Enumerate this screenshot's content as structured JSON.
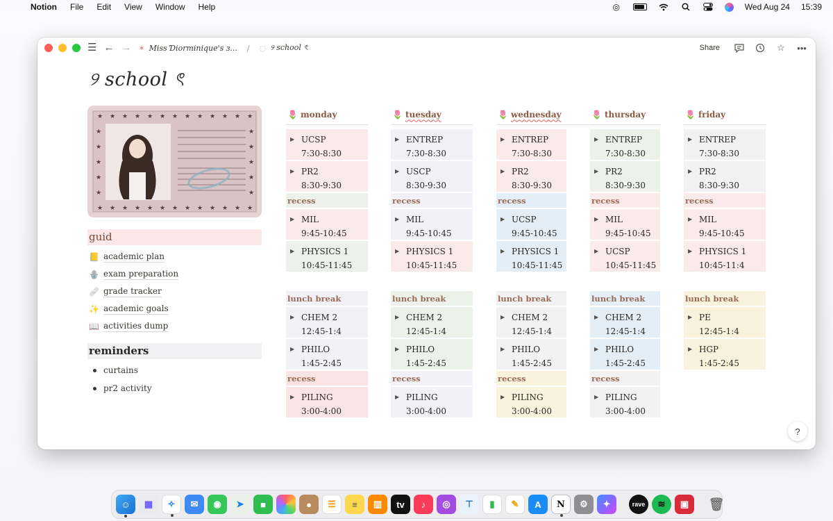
{
  "menubar": {
    "app_name": "Notion",
    "menus": [
      "File",
      "Edit",
      "View",
      "Window",
      "Help"
    ],
    "date": "Wed Aug 24",
    "time": "15:39"
  },
  "titlebar": {
    "breadcrumb_parent": "Miss Ɗiorminique's ɜ...",
    "breadcrumb_current": "୨ school ৎ",
    "share_label": "Share"
  },
  "page": {
    "title": "୨ school ৎ"
  },
  "guide": {
    "heading": "guid",
    "items": [
      {
        "emoji": "📒",
        "label": "academic plan"
      },
      {
        "emoji": "🪬",
        "label": "exam preparation"
      },
      {
        "emoji": "🩹",
        "label": "grade tracker"
      },
      {
        "emoji": "✨",
        "label": "academic goals"
      },
      {
        "emoji": "📖",
        "label": "activities dump"
      }
    ]
  },
  "reminders": {
    "heading": "reminders",
    "items": [
      "curtains",
      "pr2 activity"
    ]
  },
  "days": [
    {
      "name": "monday",
      "am": [
        {
          "subject": "UCSP",
          "time": "7:30-8:30"
        },
        {
          "subject": "PR2",
          "time": "8:30-9:30"
        }
      ],
      "recess1": "recess",
      "mid": [
        {
          "subject": "MIL",
          "time": "9:45-10:45"
        },
        {
          "subject": "PHYSICS 1",
          "time": "10:45-11:45"
        }
      ],
      "lunch": "lunch break",
      "pm": [
        {
          "subject": "CHEM 2",
          "time": "12:45-1:4"
        },
        {
          "subject": "PHILO",
          "time": "1:45-2:45"
        }
      ],
      "recess2": "recess",
      "late": [
        {
          "subject": "PILING",
          "time": "3:00-4:00"
        }
      ]
    },
    {
      "name": "tuesday",
      "am": [
        {
          "subject": "ENTREP",
          "time": "7:30-8:30"
        },
        {
          "subject": "USCP",
          "time": "8:30-9:30"
        }
      ],
      "recess1": "recess",
      "mid": [
        {
          "subject": "MIL",
          "time": "9:45-10:45"
        },
        {
          "subject": "PHYSICS 1",
          "time": "10:45-11:45"
        }
      ],
      "lunch": "lunch break",
      "pm": [
        {
          "subject": "CHEM 2",
          "time": "12:45-1:4"
        },
        {
          "subject": "PHILO",
          "time": "1:45-2:45"
        }
      ],
      "recess2": "recess",
      "late": [
        {
          "subject": "PILING",
          "time": "3:00-4:00"
        }
      ]
    },
    {
      "name": "wednesday",
      "am": [
        {
          "subject": "ENTREP",
          "time": "7:30-8:30"
        },
        {
          "subject": "PR2",
          "time": "8:30-9:30"
        }
      ],
      "recess1": "recess",
      "mid": [
        {
          "subject": "UCSP",
          "time": "9:45-10:45"
        },
        {
          "subject": "PHYSICS 1",
          "time": "10:45-11:45"
        }
      ],
      "lunch": "lunch break",
      "pm": [
        {
          "subject": "CHEM 2",
          "time": "12:45-1:4"
        },
        {
          "subject": "PHILO",
          "time": "1:45-2:45"
        }
      ],
      "recess2": "recess",
      "late": [
        {
          "subject": "PILING",
          "time": "3:00-4:00"
        }
      ]
    },
    {
      "name": "thursday",
      "am": [
        {
          "subject": "ENTREP",
          "time": "7:30-8:30"
        },
        {
          "subject": "PR2",
          "time": "8:30-9:30"
        }
      ],
      "recess1": "recess",
      "mid": [
        {
          "subject": "MIL",
          "time": "9:45-10:45"
        },
        {
          "subject": "UCSP",
          "time": "10:45-11:45"
        }
      ],
      "lunch": "lunch break",
      "pm": [
        {
          "subject": "CHEM 2",
          "time": "12:45-1:4"
        },
        {
          "subject": "PHILO",
          "time": "1:45-2:45"
        }
      ],
      "recess2": "recess",
      "late": [
        {
          "subject": "PILING",
          "time": "3:00-4:00"
        }
      ]
    },
    {
      "name": "friday",
      "am": [
        {
          "subject": "ENTREP",
          "time": "7:30-8:30"
        },
        {
          "subject": "PR2",
          "time": "8:30-9:30"
        }
      ],
      "recess1": "recess",
      "mid": [
        {
          "subject": "MIL",
          "time": "9:45-10:45"
        },
        {
          "subject": "PHYSICS 1",
          "time": "10:45-11:4"
        }
      ],
      "lunch": "lunch break",
      "pm": [
        {
          "subject": "PE",
          "time": "12:45-1:4"
        },
        {
          "subject": "HGP",
          "time": "1:45-2:45"
        }
      ]
    }
  ],
  "help_label": "?",
  "colors": {
    "accent_heading": "#8a5a44",
    "pink": "#fbeaea",
    "green": "#ecf2ea",
    "lavender": "#f2f1f6",
    "blue": "#e3eef6",
    "yellow": "#f9f2dc"
  }
}
